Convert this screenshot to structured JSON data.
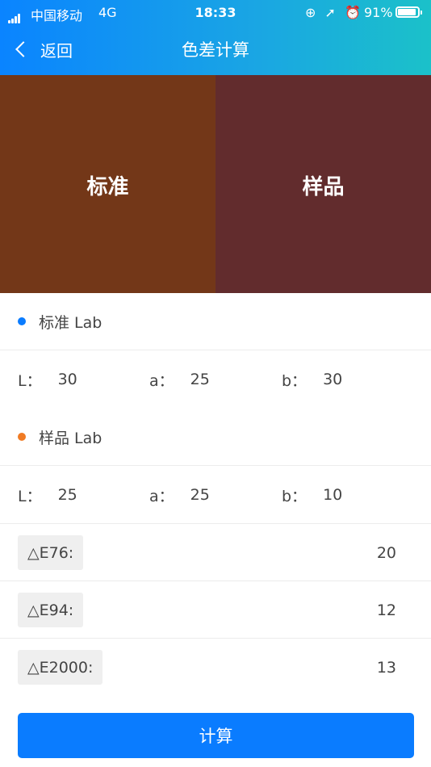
{
  "status_bar": {
    "carrier": "中国移动",
    "network": "4G",
    "time": "18:33",
    "battery_percent": "91%",
    "battery_level": 0.91,
    "icons": [
      "signal-icon",
      "rotation-lock-icon",
      "location-icon",
      "alarm-icon",
      "battery-icon"
    ]
  },
  "nav": {
    "back_label": "返回",
    "title": "色差计算"
  },
  "swatches": {
    "standard": {
      "label": "标准",
      "color": "#733718"
    },
    "sample": {
      "label": "样品",
      "color": "#622c2d"
    }
  },
  "standard_lab": {
    "title": "标准 Lab",
    "dot_color": "#0a7cff",
    "L_label": "L：",
    "L": "30",
    "a_label": "a：",
    "a": "25",
    "b_label": "b：",
    "b": "30"
  },
  "sample_lab": {
    "title": "样品 Lab",
    "dot_color": "#f07b24",
    "L_label": "L：",
    "L": "25",
    "a_label": "a：",
    "a": "25",
    "b_label": "b：",
    "b": "10"
  },
  "results": [
    {
      "label": "△E76:",
      "value": "20"
    },
    {
      "label": "△E94:",
      "value": "12"
    },
    {
      "label": "△E2000:",
      "value": "13"
    }
  ],
  "calculate_button": "计算",
  "colors": {
    "accent": "#0a7cff",
    "header_gradient_start": "#0a84ff",
    "header_gradient_end": "#1bc1c9"
  }
}
